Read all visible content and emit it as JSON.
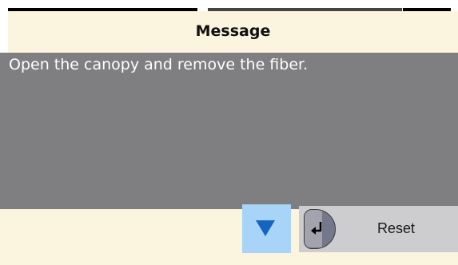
{
  "dialog": {
    "title": "Message",
    "message": "Open the canopy and remove the fiber."
  },
  "actions": {
    "scroll_down_icon": "down-triangle-icon",
    "reset_label": "Reset",
    "reset_icon": "enter-return-icon"
  },
  "colors": {
    "dialog_background": "#fbf4de",
    "message_background": "#7f7e80",
    "scroll_button": "#a7d4f7",
    "reset_button": "#cdcdcf",
    "arrow": "#1565c0"
  }
}
